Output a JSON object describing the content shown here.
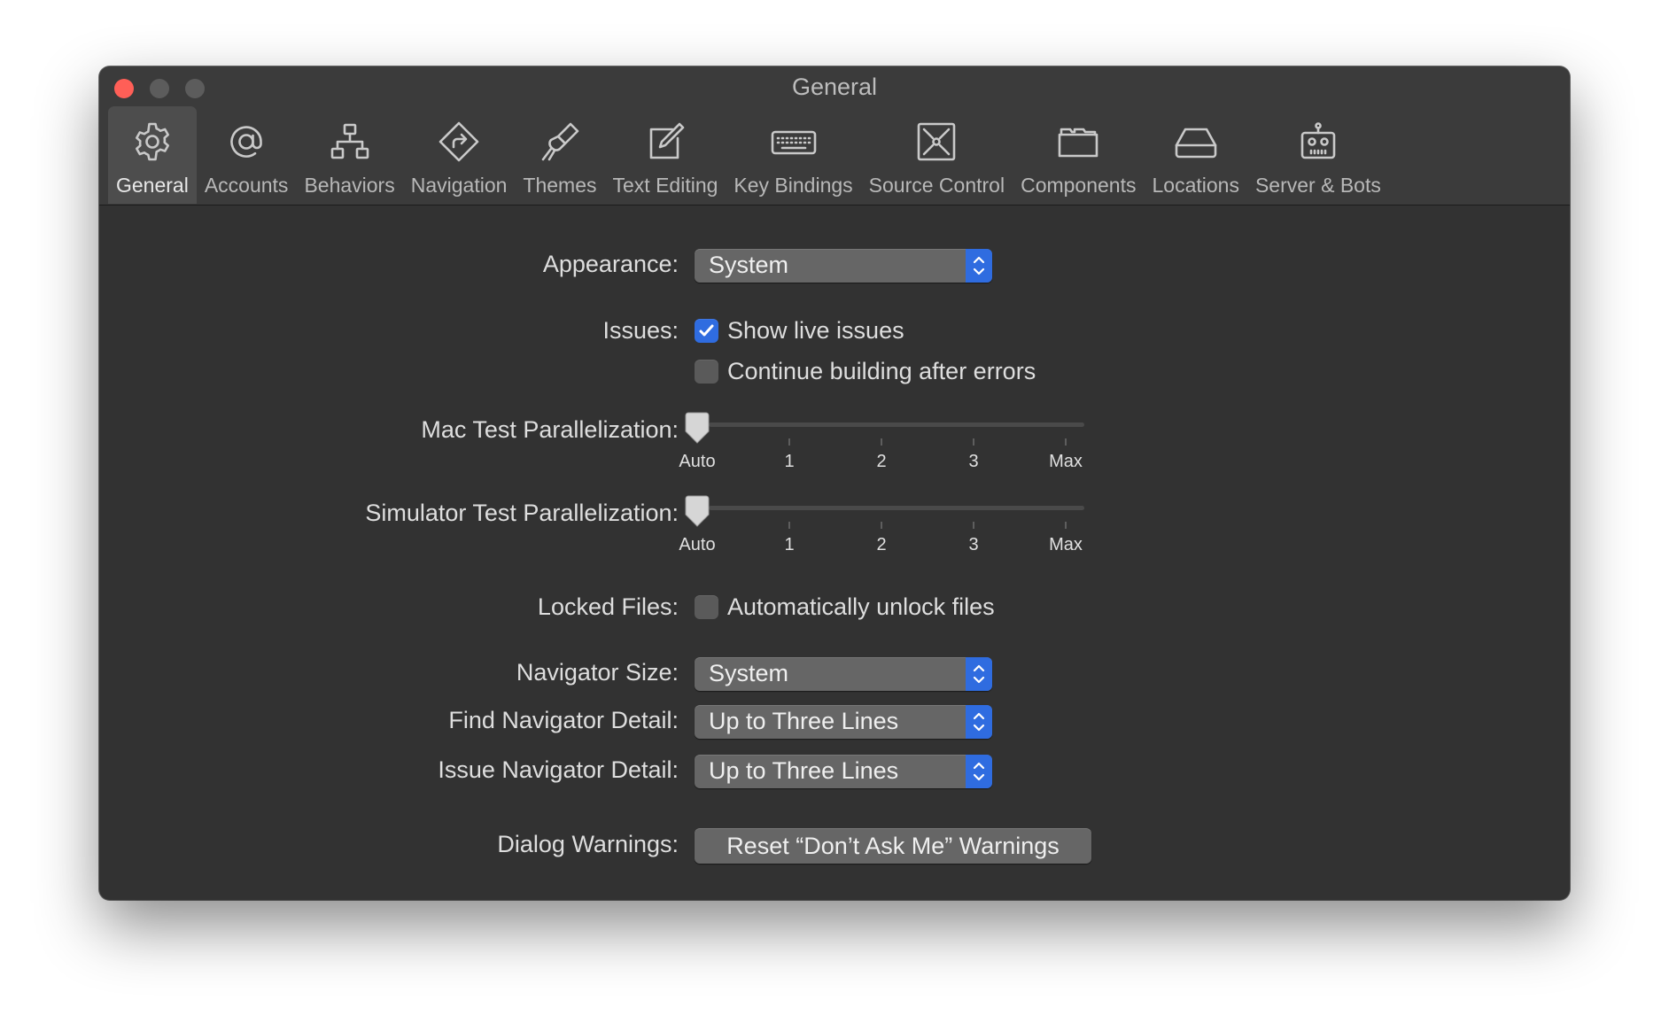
{
  "window": {
    "title": "General"
  },
  "toolbar": {
    "items": [
      {
        "label": "General",
        "icon": "gear-icon",
        "active": true
      },
      {
        "label": "Accounts",
        "icon": "at-sign-icon"
      },
      {
        "label": "Behaviors",
        "icon": "hierarchy-icon"
      },
      {
        "label": "Navigation",
        "icon": "navigation-diamond-icon"
      },
      {
        "label": "Themes",
        "icon": "paintbrush-icon"
      },
      {
        "label": "Text Editing",
        "icon": "pencil-square-icon"
      },
      {
        "label": "Key Bindings",
        "icon": "keyboard-icon"
      },
      {
        "label": "Source Control",
        "icon": "source-control-icon"
      },
      {
        "label": "Components",
        "icon": "folder-icon"
      },
      {
        "label": "Locations",
        "icon": "drive-icon"
      },
      {
        "label": "Server & Bots",
        "icon": "robot-icon"
      }
    ]
  },
  "settings": {
    "appearance": {
      "label": "Appearance:",
      "value": "System"
    },
    "issues": {
      "label": "Issues:",
      "show_live": {
        "label": "Show live issues",
        "checked": true
      },
      "continue_building": {
        "label": "Continue building after errors",
        "checked": false
      }
    },
    "mac_parallel": {
      "label": "Mac Test Parallelization:",
      "ticks": [
        "Auto",
        "1",
        "2",
        "3",
        "Max"
      ],
      "value": "Auto"
    },
    "sim_parallel": {
      "label": "Simulator Test Parallelization:",
      "ticks": [
        "Auto",
        "1",
        "2",
        "3",
        "Max"
      ],
      "value": "Auto"
    },
    "locked_files": {
      "label": "Locked Files:",
      "auto_unlock": {
        "label": "Automatically unlock files",
        "checked": false
      }
    },
    "navigator_size": {
      "label": "Navigator Size:",
      "value": "System"
    },
    "find_detail": {
      "label": "Find Navigator Detail:",
      "value": "Up to Three Lines"
    },
    "issue_detail": {
      "label": "Issue Navigator Detail:",
      "value": "Up to Three Lines"
    },
    "dialog_warnings": {
      "label": "Dialog Warnings:",
      "button": "Reset “Don’t Ask Me” Warnings"
    }
  },
  "colors": {
    "accent": "#2f6ce0",
    "close": "#ff5f57",
    "window_bg": "#323232"
  }
}
